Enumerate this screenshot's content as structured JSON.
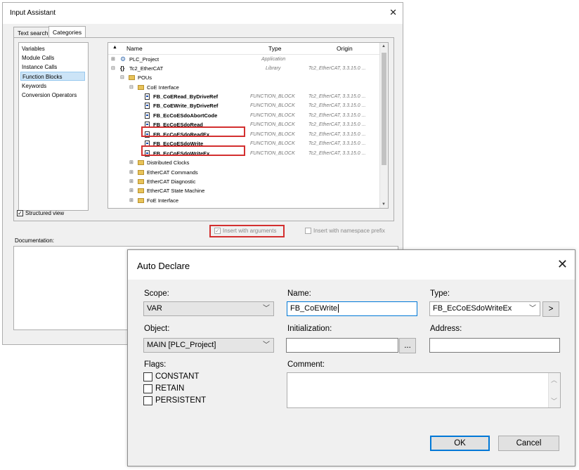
{
  "input_assistant": {
    "title": "Input Assistant",
    "close": "✕",
    "tabs": [
      "Text search",
      "Categories"
    ],
    "categories": [
      "Variables",
      "Module Calls",
      "Instance Calls",
      "Function Blocks",
      "Keywords",
      "Conversion Operators"
    ],
    "selected_category": "Function Blocks",
    "columns": {
      "name": "Name",
      "type": "Type",
      "origin": "Origin"
    },
    "tree": [
      {
        "name": "PLC_Project",
        "type": "Application",
        "origin": ""
      },
      {
        "name": "Tc2_EtherCAT",
        "type": "Library",
        "origin": "Tc2_EtherCAT, 3.3.15.0 ..."
      },
      {
        "name": "POUs",
        "type": "",
        "origin": ""
      },
      {
        "name": "CoE Interface",
        "type": "",
        "origin": ""
      },
      {
        "name": "FB_CoERead_ByDriveRef",
        "type": "FUNCTION_BLOCK",
        "origin": "Tc2_EtherCAT, 3.3.15.0 ..."
      },
      {
        "name": "FB_CoEWrite_ByDriveRef",
        "type": "FUNCTION_BLOCK",
        "origin": "Tc2_EtherCAT, 3.3.15.0 ..."
      },
      {
        "name": "FB_EcCoESdoAbortCode",
        "type": "FUNCTION_BLOCK",
        "origin": "Tc2_EtherCAT, 3.3.15.0 ..."
      },
      {
        "name": "FB_EcCoESdoRead",
        "type": "FUNCTION_BLOCK",
        "origin": "Tc2_EtherCAT, 3.3.15.0 ..."
      },
      {
        "name": "FB_EcCoESdoReadEx",
        "type": "FUNCTION_BLOCK",
        "origin": "Tc2_EtherCAT, 3.3.15.0 ..."
      },
      {
        "name": "FB_EcCoESdoWrite",
        "type": "FUNCTION_BLOCK",
        "origin": "Tc2_EtherCAT, 3.3.15.0 ..."
      },
      {
        "name": "FB_EcCoESdoWriteEx",
        "type": "FUNCTION_BLOCK",
        "origin": "Tc2_EtherCAT, 3.3.15.0 ..."
      },
      {
        "name": "Distributed Clocks",
        "type": "",
        "origin": ""
      },
      {
        "name": "EtherCAT Commands",
        "type": "",
        "origin": ""
      },
      {
        "name": "EtherCAT Diagnostic",
        "type": "",
        "origin": ""
      },
      {
        "name": "EtherCAT State Machine",
        "type": "",
        "origin": ""
      },
      {
        "name": "FoE Interface",
        "type": "",
        "origin": ""
      }
    ],
    "structured_view": "Structured view",
    "insert_with_arguments": "Insert with arguments",
    "insert_with_namespace_prefix": "Insert with namespace prefix",
    "documentation_label": "Documentation:"
  },
  "auto_declare": {
    "title": "Auto Declare",
    "close": "✕",
    "scope_label": "Scope:",
    "scope_value": "VAR",
    "name_label": "Name:",
    "name_value": "FB_CoEWrite",
    "type_label": "Type:",
    "type_value": "FB_EcCoESdoWriteEx",
    "type_button": ">",
    "object_label": "Object:",
    "object_value": "MAIN [PLC_Project]",
    "initialization_label": "Initialization:",
    "initialization_value": "",
    "init_button": "...",
    "address_label": "Address:",
    "address_value": "",
    "flags_label": "Flags:",
    "flags": [
      "CONSTANT",
      "RETAIN",
      "PERSISTENT"
    ],
    "comment_label": "Comment:",
    "ok": "OK",
    "cancel": "Cancel"
  },
  "colors": {
    "highlight": "#d32f2f",
    "focus": "#0078d7",
    "selection": "#cce4f7"
  }
}
